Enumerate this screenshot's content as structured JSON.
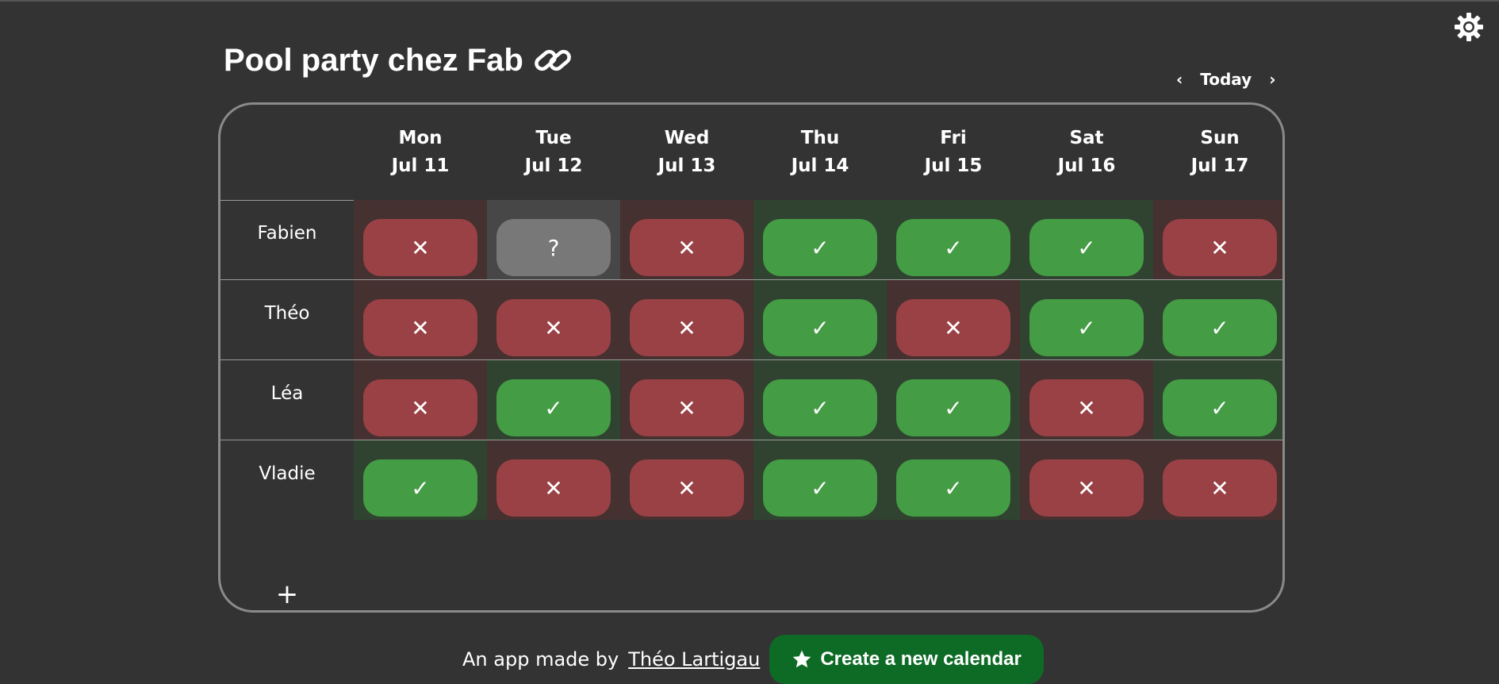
{
  "title": "Pool party chez Fab",
  "icons": {
    "settings": "gear-icon",
    "link": "link-icon",
    "prev": "chevron-left-icon",
    "next": "chevron-right-icon",
    "add": "plus-icon",
    "star": "star-icon",
    "yes": "check-icon",
    "no": "cross-icon"
  },
  "colors": {
    "background": "#333333",
    "yes": "#449c45",
    "no": "#9a4145",
    "maybe": "#787878",
    "create_button": "#0e6b26"
  },
  "nav": {
    "prev": "‹",
    "today": "Today",
    "next": "›"
  },
  "days": [
    {
      "dow": "Mon",
      "date": "Jul 11"
    },
    {
      "dow": "Tue",
      "date": "Jul 12"
    },
    {
      "dow": "Wed",
      "date": "Jul 13"
    },
    {
      "dow": "Thu",
      "date": "Jul 14"
    },
    {
      "dow": "Fri",
      "date": "Jul 15"
    },
    {
      "dow": "Sat",
      "date": "Jul 16"
    },
    {
      "dow": "Sun",
      "date": "Jul 17"
    }
  ],
  "marks": {
    "yes": "✓",
    "no": "✕",
    "maybe": "?"
  },
  "people": [
    {
      "name": "Fabien",
      "availability": [
        "no",
        "maybe",
        "no",
        "yes",
        "yes",
        "yes",
        "no"
      ]
    },
    {
      "name": "Théo",
      "availability": [
        "no",
        "no",
        "no",
        "yes",
        "no",
        "yes",
        "yes"
      ]
    },
    {
      "name": "Léa",
      "availability": [
        "no",
        "yes",
        "no",
        "yes",
        "yes",
        "no",
        "yes"
      ]
    },
    {
      "name": "Vladie",
      "availability": [
        "yes",
        "no",
        "no",
        "yes",
        "yes",
        "no",
        "no"
      ]
    }
  ],
  "add_person": "+",
  "footer": {
    "text": "An app made by",
    "author": "Théo Lartigau",
    "create_button": "Create a new calendar"
  }
}
